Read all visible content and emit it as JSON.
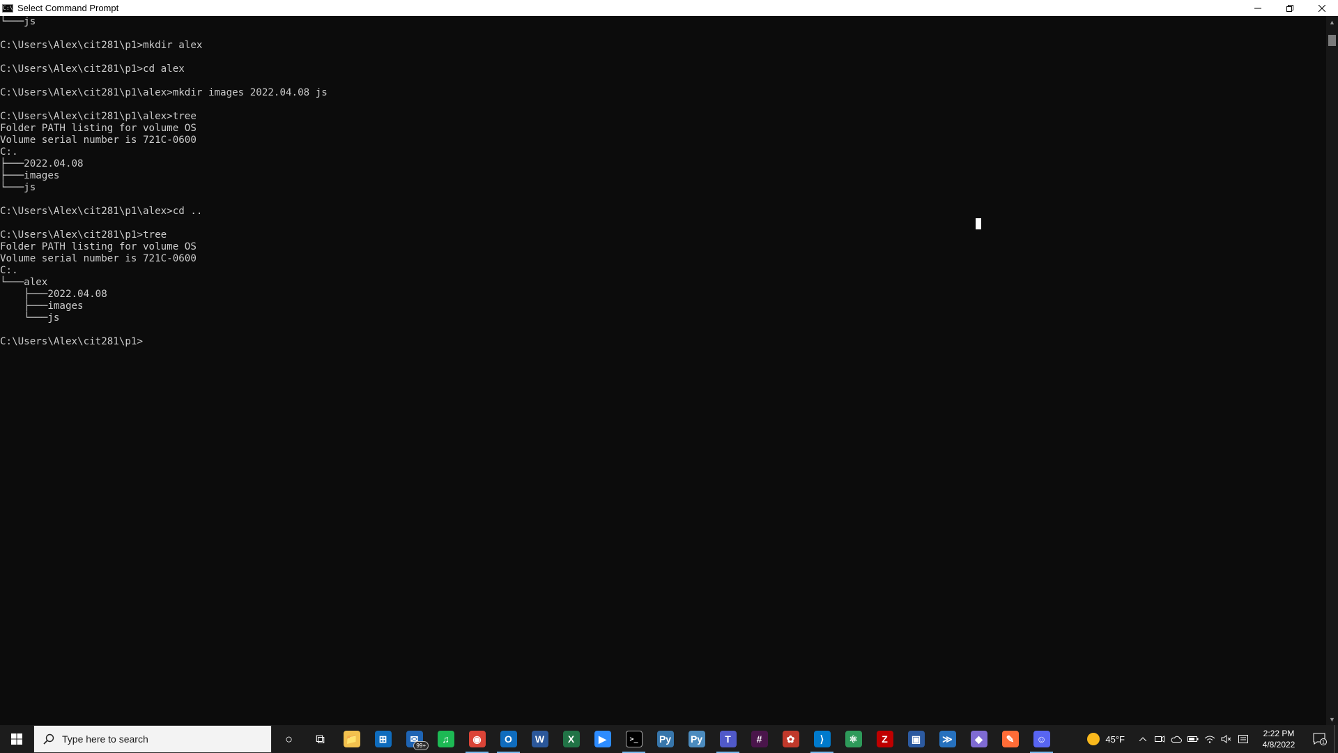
{
  "window": {
    "title": "Select Command Prompt",
    "icon": "cmd-icon",
    "icon_glyph": "C:\\"
  },
  "console": {
    "lines": [
      "└───js",
      "",
      "C:\\Users\\Alex\\cit281\\p1>mkdir alex",
      "",
      "C:\\Users\\Alex\\cit281\\p1>cd alex",
      "",
      "C:\\Users\\Alex\\cit281\\p1\\alex>mkdir images 2022.04.08 js",
      "",
      "C:\\Users\\Alex\\cit281\\p1\\alex>tree",
      "Folder PATH listing for volume OS",
      "Volume serial number is 721C-0600",
      "C:.",
      "├───2022.04.08",
      "├───images",
      "└───js",
      "",
      "C:\\Users\\Alex\\cit281\\p1\\alex>cd ..",
      "",
      "C:\\Users\\Alex\\cit281\\p1>tree",
      "Folder PATH listing for volume OS",
      "Volume serial number is 721C-0600",
      "C:.",
      "└───alex",
      "    ├───2022.04.08",
      "    ├───images",
      "    └───js",
      "",
      "C:\\Users\\Alex\\cit281\\p1>"
    ]
  },
  "taskbar": {
    "search_placeholder": "Type here to search",
    "apps": [
      {
        "name": "cortana-icon",
        "glyph": "○",
        "color": "transparent",
        "active": false
      },
      {
        "name": "task-view-icon",
        "glyph": "⧉",
        "color": "transparent",
        "active": false
      },
      {
        "name": "file-explorer-icon",
        "glyph": "📁",
        "color": "#f2c14e",
        "active": false
      },
      {
        "name": "microsoft-store-icon",
        "glyph": "⊞",
        "color": "#0f6cbd",
        "active": false
      },
      {
        "name": "mail-icon",
        "glyph": "✉",
        "color": "#1e64b4",
        "active": false,
        "badge": "99+"
      },
      {
        "name": "spotify-icon",
        "glyph": "♫",
        "color": "#1db954",
        "active": false
      },
      {
        "name": "chrome-icon",
        "glyph": "◉",
        "color": "#db4437",
        "active": true
      },
      {
        "name": "outlook-icon",
        "glyph": "O",
        "color": "#0f6cbd",
        "active": true
      },
      {
        "name": "word-icon",
        "glyph": "W",
        "color": "#2b579a",
        "active": false
      },
      {
        "name": "excel-icon",
        "glyph": "X",
        "color": "#217346",
        "active": false
      },
      {
        "name": "zoom-icon",
        "glyph": "▶",
        "color": "#2d8cff",
        "active": false
      },
      {
        "name": "command-prompt-icon",
        "glyph": ">_",
        "color": "#000000",
        "active": true
      },
      {
        "name": "python-icon",
        "glyph": "Py",
        "color": "#3776ab",
        "active": false
      },
      {
        "name": "python-idle-icon",
        "glyph": "Py",
        "color": "#4b8bbe",
        "active": false
      },
      {
        "name": "teams-icon",
        "glyph": "T",
        "color": "#5059c9",
        "active": true
      },
      {
        "name": "slack-icon",
        "glyph": "#",
        "color": "#4a154b",
        "active": false
      },
      {
        "name": "paint-icon",
        "glyph": "✿",
        "color": "#c0392b",
        "active": false
      },
      {
        "name": "vscode-icon",
        "glyph": "⟩",
        "color": "#007acc",
        "active": true
      },
      {
        "name": "atom-icon",
        "glyph": "⚛",
        "color": "#2e9a5a",
        "active": false
      },
      {
        "name": "filezilla-icon",
        "glyph": "Z",
        "color": "#bf0000",
        "active": false
      },
      {
        "name": "remote-desktop-icon",
        "glyph": "▣",
        "color": "#2c5aa0",
        "active": false
      },
      {
        "name": "powershell-icon",
        "glyph": "≫",
        "color": "#2671be",
        "active": false
      },
      {
        "name": "gitkraken-icon",
        "glyph": "◆",
        "color": "#7f6bd3",
        "active": false
      },
      {
        "name": "postman-icon",
        "glyph": "✎",
        "color": "#ff6c37",
        "active": false
      },
      {
        "name": "discord-icon",
        "glyph": "☺",
        "color": "#5865f2",
        "active": true
      }
    ]
  },
  "tray": {
    "temperature": "45°F",
    "time": "2:22 PM",
    "date": "4/8/2022",
    "notification_count": "1"
  }
}
